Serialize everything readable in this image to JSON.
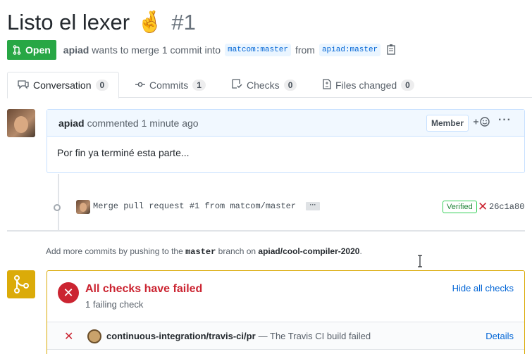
{
  "pr": {
    "title": "Listo el lexer",
    "emoji": "🤞",
    "number": "#1",
    "state": "Open",
    "author": "apiad",
    "action_text": "wants to merge 1 commit into",
    "base_branch": "matcom:master",
    "from_text": "from",
    "head_branch": "apiad:master"
  },
  "tabs": [
    {
      "label": "Conversation",
      "count": "0"
    },
    {
      "label": "Commits",
      "count": "1"
    },
    {
      "label": "Checks",
      "count": "0"
    },
    {
      "label": "Files changed",
      "count": "0"
    }
  ],
  "comment": {
    "author": "apiad",
    "meta": "commented 1 minute ago",
    "role": "Member",
    "body": "Por fin ya terminé esta parte..."
  },
  "commit": {
    "message": "Merge pull request #1 from matcom/master",
    "verified": "Verified",
    "sha": "26c1a80"
  },
  "hint": {
    "prefix": "Add more commits by pushing to the",
    "branch": "master",
    "middle": "branch on",
    "repo": "apiad/cool-compiler-2020",
    "suffix": "."
  },
  "checks": {
    "title": "All checks have failed",
    "subtitle": "1 failing check",
    "hide_label": "Hide all checks",
    "rows": [
      {
        "name": "continuous-integration/travis-ci/pr",
        "description": "— The Travis CI build failed",
        "link": "Details"
      }
    ]
  },
  "colors": {
    "open": "#28a745",
    "fail": "#cb2431",
    "pending": "#dbab09",
    "link": "#0366d6"
  }
}
